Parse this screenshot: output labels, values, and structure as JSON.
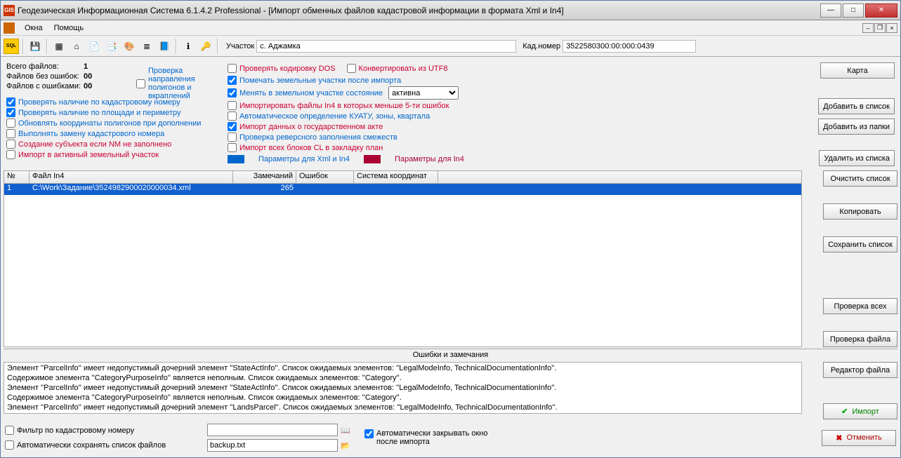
{
  "title": "Геодезическая Информационная Система 6.1.4.2 Professional - [Импорт обменных файлов кадастровой информации в формата Xml и In4]",
  "menu": {
    "okna": "Окна",
    "pomosh": "Помощь"
  },
  "toolbar": {
    "uchastok_lbl": "Участок",
    "uchastok_val": "с. Аджамка",
    "kad_lbl": "Кад.номер",
    "kad_val": "3522580300:00:000:0439"
  },
  "stats": {
    "total_lbl": "Всего файлов:",
    "total_val": "1",
    "ok_lbl": "Файлов без ошибок:",
    "ok_val": "00",
    "err_lbl": "Файлов с ошибками:",
    "err_val": "00"
  },
  "left_checks": {
    "poly": "Проверка направления полигонов и вкраплений",
    "c1": "Проверять наличие по кадастровому номеру",
    "c2": "Проверять наличие по площади и периметру",
    "c3": "Обновлять координаты полигонов при дополнении",
    "c4": "Выполнять замену кадастрового номера",
    "c5": "Создание субъекта если NM не заполнено",
    "c6": "Импорт в активный земельный участок"
  },
  "mid_checks": {
    "c1": "Проверять кодировку DOS",
    "c1b": "Конвертировать из UTF8",
    "c2": "Помечать земельные участки после импорта",
    "c3": "Менять в земельном участке состояние",
    "c3_sel": "активна",
    "c4": "Импортировать файлы In4 в которых меньше 5-ти ошибок",
    "c5": "Автоматическое определение КУАТУ, зоны, квартала",
    "c6": "Импорт данных о государственном акте",
    "c7": "Проверка реверсного заполнения смежеств",
    "c8": "Импорт всех блоков CL в закладку план",
    "leg_xml": "Параметры для Xml и In4",
    "leg_in4": "Параметры для In4"
  },
  "buttons": {
    "karta": "Карта",
    "add_list": "Добавить в список",
    "add_folder": "Добавить из папки",
    "del_list": "Удалить из списка",
    "clear_list": "Очистить список",
    "copy": "Копировать",
    "save_list": "Сохранить список",
    "check_all": "Проверка всех",
    "check_file": "Проверка файла",
    "editor": "Редактор файла",
    "import": "Импорт",
    "cancel": "Отменить"
  },
  "table": {
    "h_n": "№",
    "h_file": "Файл In4",
    "h_rem": "Замечаний",
    "h_err": "Ошибок",
    "h_cs": "Система координат",
    "rows": [
      {
        "n": "1",
        "file": "C:\\Work\\Задание\\3524982900020000034.xml",
        "rem": "265",
        "err": "",
        "cs": ""
      }
    ]
  },
  "errors": {
    "title": "Ошибки и замечания",
    "lines": [
      "Элемент ''ParcelInfo'' имеет недопустимый дочерний элемент ''StateActInfo''. Список ожидаемых элементов: ''LegalModeInfo, TechnicalDocumentationInfo''.",
      "Содержимое элемента ''CategoryPurposeInfo'' является неполным. Список ожидаемых элементов: ''Category''.",
      "Элемент ''ParcelInfo'' имеет недопустимый дочерний элемент ''StateActInfo''. Список ожидаемых элементов: ''LegalModeInfo, TechnicalDocumentationInfo''.",
      "Содержимое элемента ''CategoryPurposeInfo'' является неполным. Список ожидаемых элементов: ''Category''.",
      "Элемент ''ParcelInfo'' имеет недопустимый дочерний элемент ''LandsParcel''. Список ожидаемых элементов: ''LegalModeInfo, TechnicalDocumentationInfo''."
    ]
  },
  "bottom": {
    "filter_lbl": "Фильтр по кадастровому номеру",
    "autosave_lbl": "Автоматически сохранять список файлов",
    "autosave_val": "backup.txt",
    "autoclose_lbl": "Автоматически закрывать окно после импорта"
  }
}
